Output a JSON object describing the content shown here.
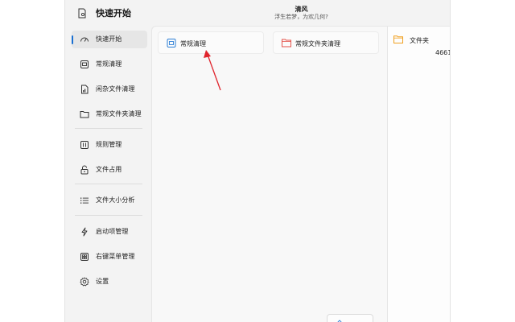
{
  "app": {
    "title": "快速开始",
    "header_title": "清风",
    "header_subtitle": "浮生若梦，为欢几何?"
  },
  "sidebar": {
    "items": [
      {
        "label": "快速开始",
        "icon": "speedometer-icon",
        "active": true
      },
      {
        "label": "常规清理",
        "icon": "cleanup-icon"
      },
      {
        "label": "闲杂文件清理",
        "icon": "file-chart-icon"
      },
      {
        "label": "常规文件夹清理",
        "icon": "folder-icon"
      },
      {
        "label": "规则管理",
        "icon": "rules-icon"
      },
      {
        "label": "文件占用",
        "icon": "lock-icon"
      },
      {
        "label": "文件大小分析",
        "icon": "list-icon"
      },
      {
        "label": "启动项管理",
        "icon": "startup-icon"
      },
      {
        "label": "右键菜单管理",
        "icon": "context-menu-icon"
      },
      {
        "label": "设置",
        "icon": "gear-icon"
      }
    ]
  },
  "cards": [
    {
      "label": "常规清理",
      "icon": "cleanup-icon"
    },
    {
      "label": "常规文件夹清理",
      "icon": "folder-icon"
    }
  ],
  "panel": {
    "label": "文件夹",
    "icon": "folder-icon",
    "value": "4661"
  },
  "colors": {
    "accent": "#1a6fd1",
    "folder_red": "#e4524a",
    "folder_orange": "#f0a020",
    "cleanup_blue": "#2d7fd6",
    "arrow_red": "#e0242c"
  }
}
